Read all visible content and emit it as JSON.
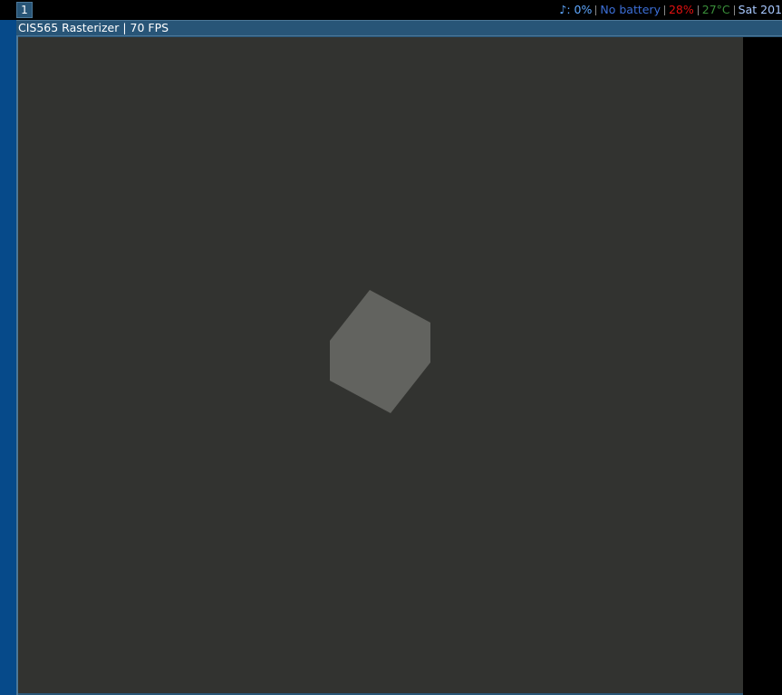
{
  "workspace": {
    "number": "1"
  },
  "status_bar": {
    "volume": "♪: 0%",
    "battery": "No battery",
    "cpu": "28%",
    "temperature": "27°C",
    "date": "Sat 201"
  },
  "window": {
    "title": "CIS565 Rasterizer | 70 FPS"
  },
  "colors": {
    "background": "#323330",
    "shape_fill": "#62635f",
    "titlebar": "#285577"
  }
}
